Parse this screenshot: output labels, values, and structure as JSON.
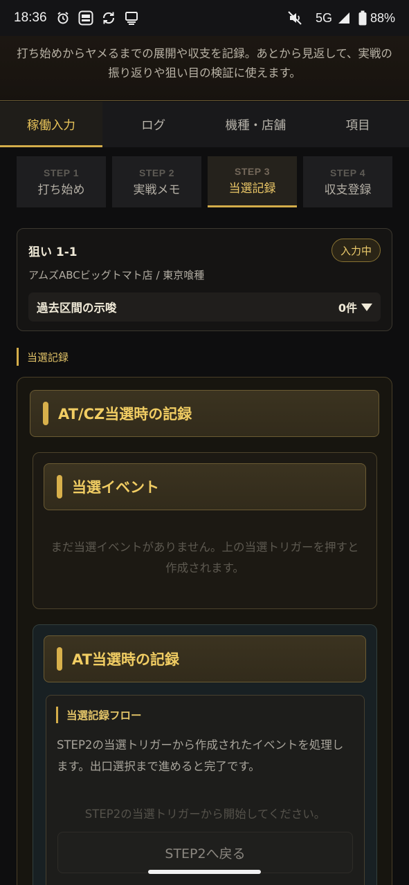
{
  "status_bar": {
    "time": "18:36",
    "network": "5G",
    "battery": "88%",
    "icons": [
      "alarm-icon",
      "app-notification-icon",
      "sync-icon",
      "cast-icon",
      "mute-icon",
      "signal-icon",
      "battery-icon"
    ]
  },
  "intro": {
    "text": "打ち始めからヤメるまでの展開や収支を記録。あとから見返して、実戦の振り返りや狙い目の検証に使えます。"
  },
  "top_tabs": [
    {
      "label": "稼働入力",
      "active": true
    },
    {
      "label": "ログ",
      "active": false
    },
    {
      "label": "機種・店舗",
      "active": false
    },
    {
      "label": "項目",
      "active": false
    }
  ],
  "steps": [
    {
      "num": "STEP 1",
      "label": "打ち始め",
      "active": false
    },
    {
      "num": "STEP 2",
      "label": "実戦メモ",
      "active": false
    },
    {
      "num": "STEP 3",
      "label": "当選記録",
      "active": true
    },
    {
      "num": "STEP 4",
      "label": "収支登録",
      "active": false
    }
  ],
  "target": {
    "name": "狙い 1-1",
    "status": "入力中",
    "store": "アムズABCビッグトマト店 / 東京喰種",
    "hint_label": "過去区間の示唆",
    "hint_count": "0件"
  },
  "section": {
    "label": "当選記録"
  },
  "record": {
    "heading": "AT/CZ当選時の記録",
    "event_heading": "当選イベント",
    "event_empty": "まだ当選イベントがありません。上の当選トリガーを押すと作成されます。",
    "at_heading": "AT当選時の記録",
    "flow_title": "当選記録フロー",
    "flow_desc": "STEP2の当選トリガーから作成されたイベントを処理します。出口選択まで進めると完了です。",
    "flow_hint": "STEP2の当選トリガーから開始してください。",
    "back_button": "STEP2へ戻る"
  },
  "colors": {
    "accent": "#d4ad4a",
    "accent_text": "#e9c45a",
    "background": "#0e0e0f"
  }
}
